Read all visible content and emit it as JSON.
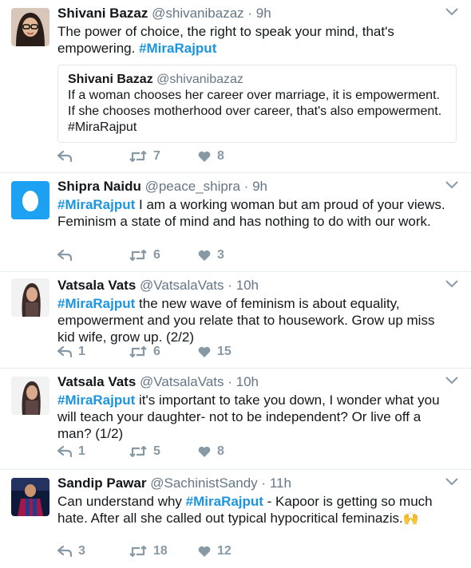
{
  "tweets": [
    {
      "fullname": "Shivani Bazaz",
      "username": "@shivanibazaz",
      "separator": "·",
      "time": "9h",
      "text_before": "The power of choice, the right to speak your mind, that's empowering. ",
      "hashtag": "#MiraRajput",
      "text_after": "",
      "quote": {
        "fullname": "Shivani Bazaz",
        "username": "@shivanibazaz",
        "text": "If a woman chooses her career over marriage, it is empowerment. If she chooses motherhood over career, that's also empowerment. #MiraRajput"
      },
      "replies": "",
      "retweets": "7",
      "likes": "8",
      "avatar": "woman-with-glasses-photo"
    },
    {
      "fullname": "Shipra Naidu",
      "username": "@peace_shipra",
      "separator": "·",
      "time": "9h",
      "text_before": "",
      "hashtag": "#MiraRajput",
      "text_after": " I am a working woman but am proud of your views. Feminism a state of mind and has nothing to do with our work.",
      "replies": "",
      "retweets": "6",
      "likes": "3",
      "avatar": "default-egg-avatar"
    },
    {
      "fullname": "Vatsala Vats",
      "username": "@VatsalaVats",
      "separator": "·",
      "time": "10h",
      "text_before": "",
      "hashtag": "#MiraRajput",
      "text_after": " the new wave of feminism is about equality, empowerment and you relate that to housework. Grow up miss kid wife, grow up. (2/2)",
      "replies": "1",
      "retweets": "6",
      "likes": "15",
      "avatar": "woman-photo"
    },
    {
      "fullname": "Vatsala Vats",
      "username": "@VatsalaVats",
      "separator": "·",
      "time": "10h",
      "text_before": "",
      "hashtag": "#MiraRajput",
      "text_after": " it's important to take you down, I wonder what you will teach your daughter- not to be independent? Or live off a man? (1/2)",
      "replies": "1",
      "retweets": "5",
      "likes": "8",
      "avatar": "woman-photo"
    },
    {
      "fullname": "Sandip Pawar",
      "username": "@SachinistSandy",
      "separator": "·",
      "time": "11h",
      "text_before": "Can understand why ",
      "hashtag": "#MiraRajput",
      "text_after": " - Kapoor is getting so much hate. After all she called out typical hypocritical feminazis.",
      "emoji": "🙌",
      "replies": "3",
      "retweets": "18",
      "likes": "12",
      "avatar": "football-player-photo"
    }
  ],
  "colors": {
    "hashtag": "#1b95e0",
    "muted": "#657786",
    "icon": "#8899a6",
    "egg_avatar_bg": "#1da1f2"
  }
}
